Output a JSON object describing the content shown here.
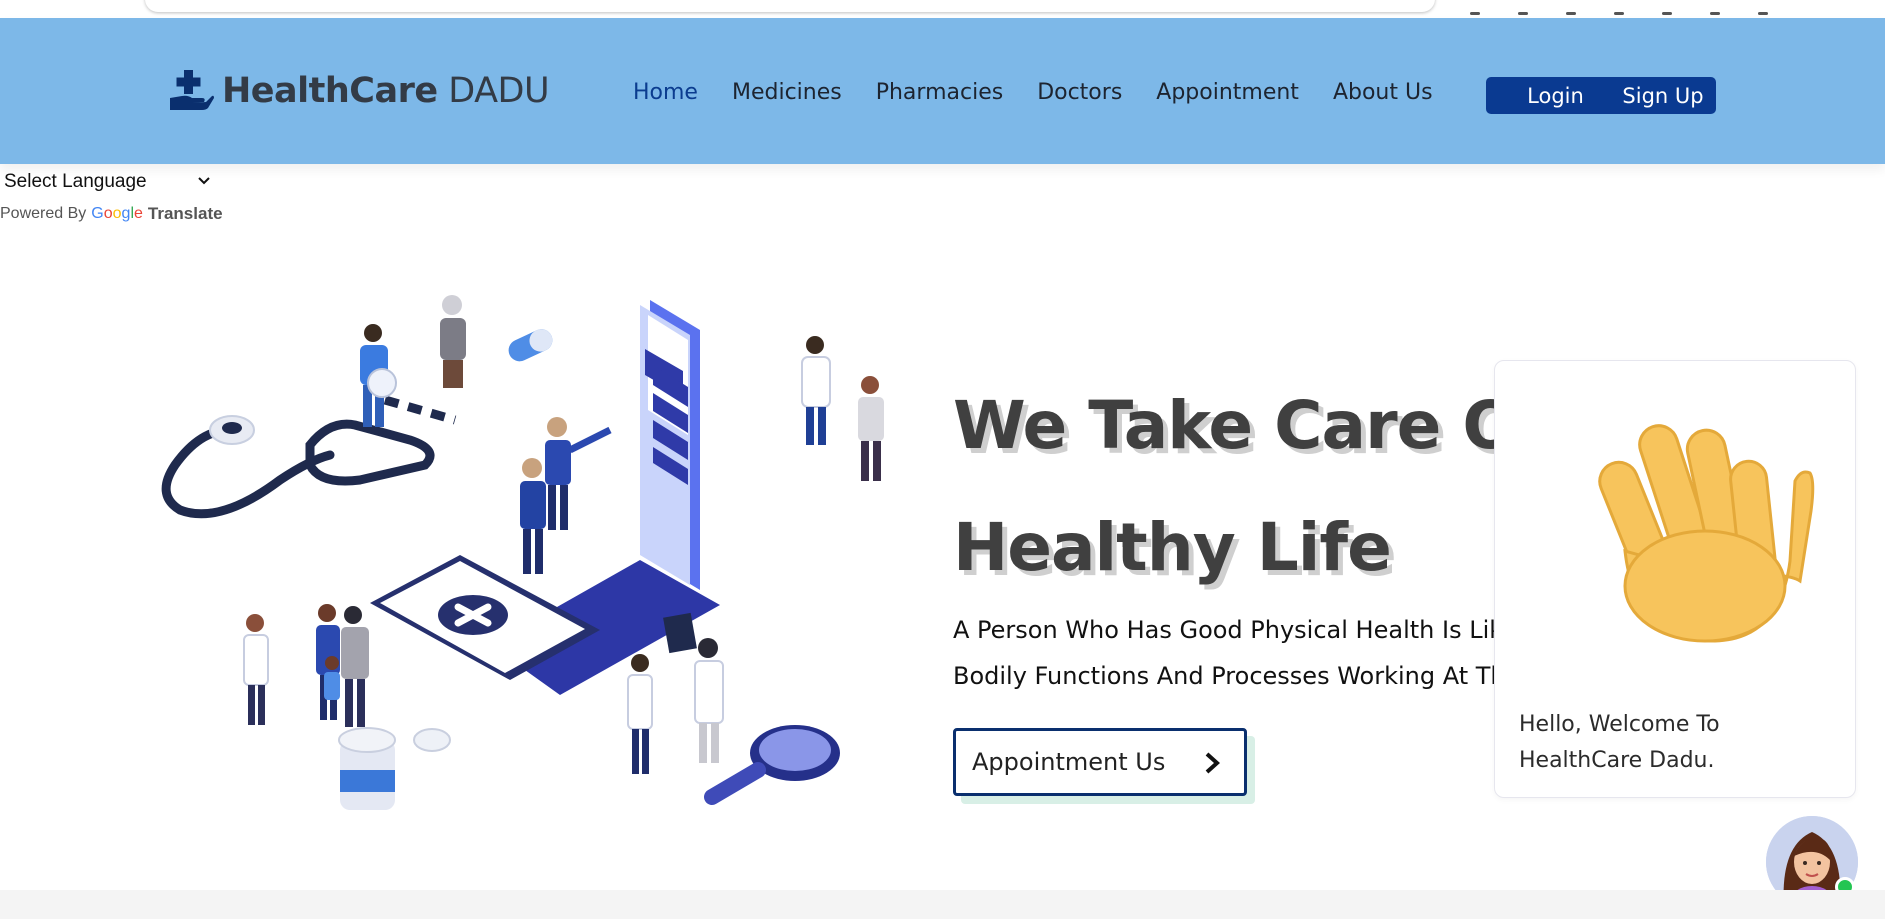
{
  "header": {
    "logo": {
      "bold": "HealthCare",
      "light": "DADU"
    },
    "nav": [
      {
        "label": "Home",
        "active": true
      },
      {
        "label": "Medicines"
      },
      {
        "label": "Pharmacies"
      },
      {
        "label": "Doctors"
      },
      {
        "label": "Appointment"
      },
      {
        "label": "About Us"
      }
    ],
    "login_label": "Login",
    "signup_label": "Sign Up",
    "colors": {
      "header_bg": "#7db8e8",
      "button_bg": "#0a3a91"
    }
  },
  "translate": {
    "select_label": "Select Language",
    "powered_by": "Powered By",
    "google": "Google",
    "translate": "Translate"
  },
  "hero": {
    "title_line1": "We Take Care Of Your",
    "title_line2": "Healthy Life",
    "subtitle_line1": "A Person Who Has Good Physical Health Is Likely To Have",
    "subtitle_line2": "Bodily Functions And Processes Working At Their Peak.",
    "cta_label": "Appointment Us"
  },
  "chat": {
    "greeting_icon": "waving-hand-icon",
    "message": "Hello, Welcome To HealthCare Dadu.",
    "status_color": "#23c552"
  }
}
